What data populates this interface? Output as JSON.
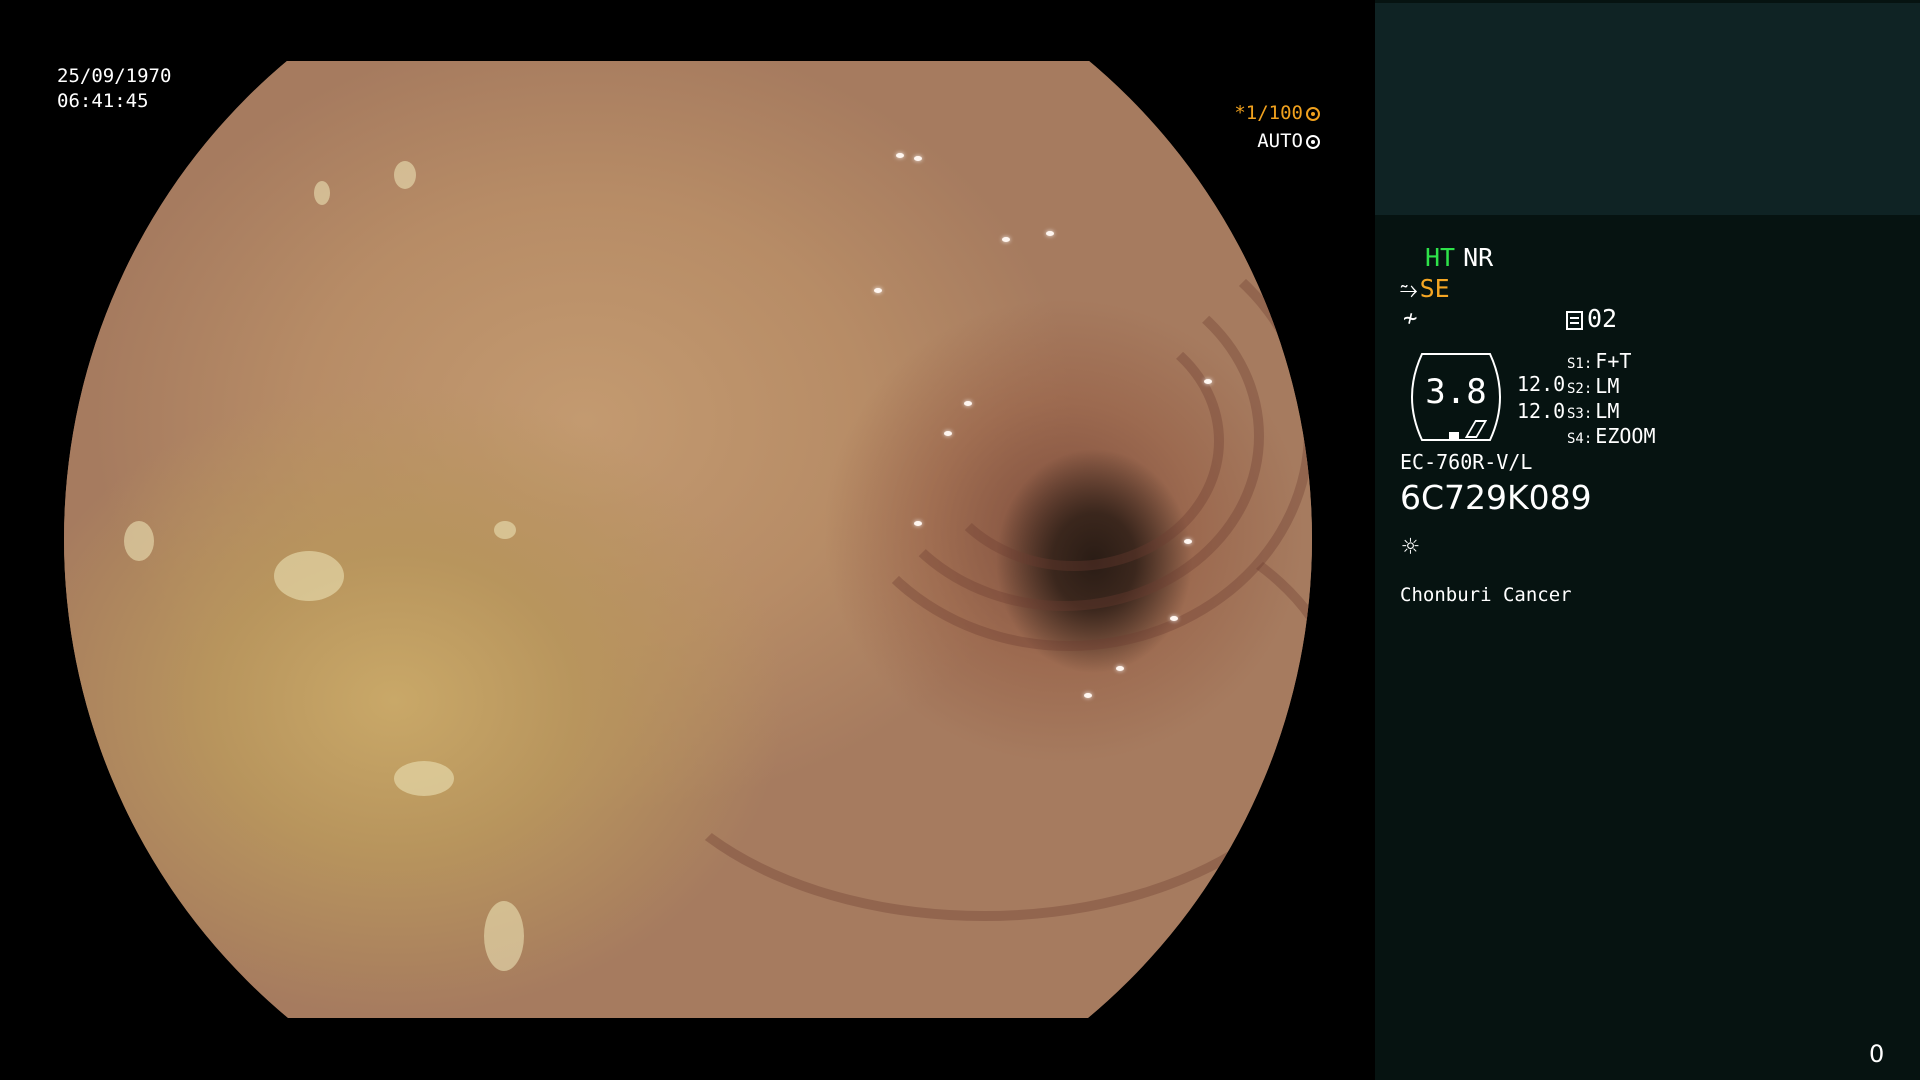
{
  "overlay": {
    "date": "25/09/1970",
    "time": "06:41:45",
    "shutter": "*1/100",
    "shutter_icon": "aperture-icon",
    "exposure_mode": "AUTO",
    "exposure_icon": "iris-icon"
  },
  "panel": {
    "ht_label": "HT",
    "nr_label": "NR",
    "se_label": "SE",
    "se_icon": "structure-enhance-icon",
    "neq_icon": "≁",
    "mem_icon": "memory-icon",
    "mem_value": "02",
    "scope_value": "3.8",
    "scale_top": "12.0",
    "scale_bottom": "12.0",
    "switches": [
      {
        "key": "S1:",
        "value": "F+T"
      },
      {
        "key": "S2:",
        "value": "LM"
      },
      {
        "key": "S3:",
        "value": "LM"
      },
      {
        "key": "S4:",
        "value": "EZOOM"
      }
    ],
    "scope_model": "EC-760R-V/L",
    "scope_serial": "6C729K089",
    "light_icon": "☼",
    "institution": "Chonburi Cancer",
    "counter": "0"
  },
  "colors": {
    "ht": "#2ee24a",
    "se": "#f5a623",
    "shutter": "#f0a11e",
    "panel_bg": "#061311",
    "patient_bg": "#0f2324"
  }
}
